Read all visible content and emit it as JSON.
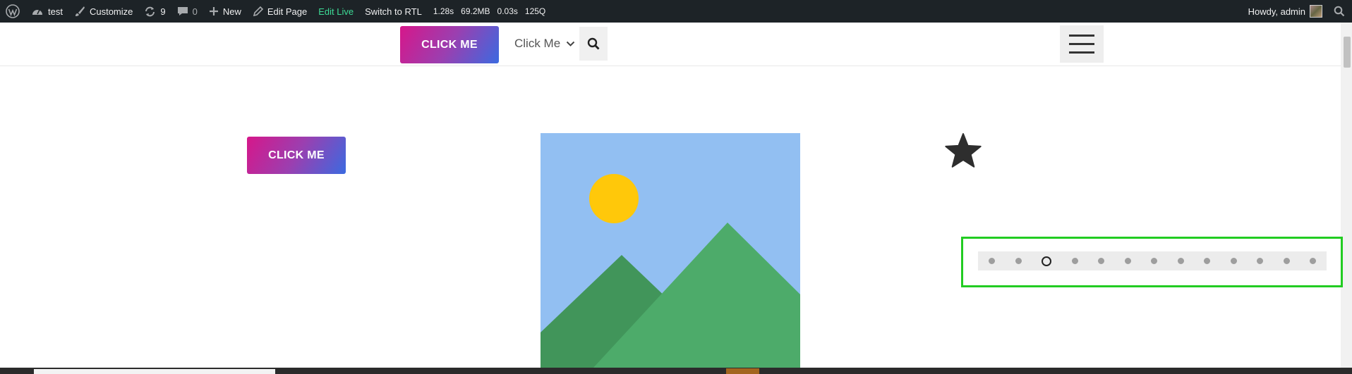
{
  "admin_bar": {
    "site_name": "test",
    "customize": "Customize",
    "updates_count": "9",
    "comments_count": "0",
    "new": "New",
    "edit_page": "Edit Page",
    "edit_live": "Edit Live",
    "switch_rtl": "Switch to RTL",
    "metrics": [
      "1.28s",
      "69.2MB",
      "0.03s",
      "125Q"
    ],
    "howdy": "Howdy, admin"
  },
  "header": {
    "button_label": "CLICK ME",
    "menu_label": "Click Me"
  },
  "content": {
    "button_label": "CLICK ME"
  },
  "carousel": {
    "dot_count": 13,
    "active_index": 2
  },
  "colors": {
    "admin_bar_bg": "#1d2327",
    "edit_live": "#3ddc97",
    "button_gradient": [
      "#d6178a",
      "#3b6ae0"
    ],
    "highlight_frame": "#22cc22",
    "sky": "#92bff2",
    "sun": "#ffc80a",
    "mountain_back": "#41955a",
    "mountain_front": "#4dab6a"
  }
}
